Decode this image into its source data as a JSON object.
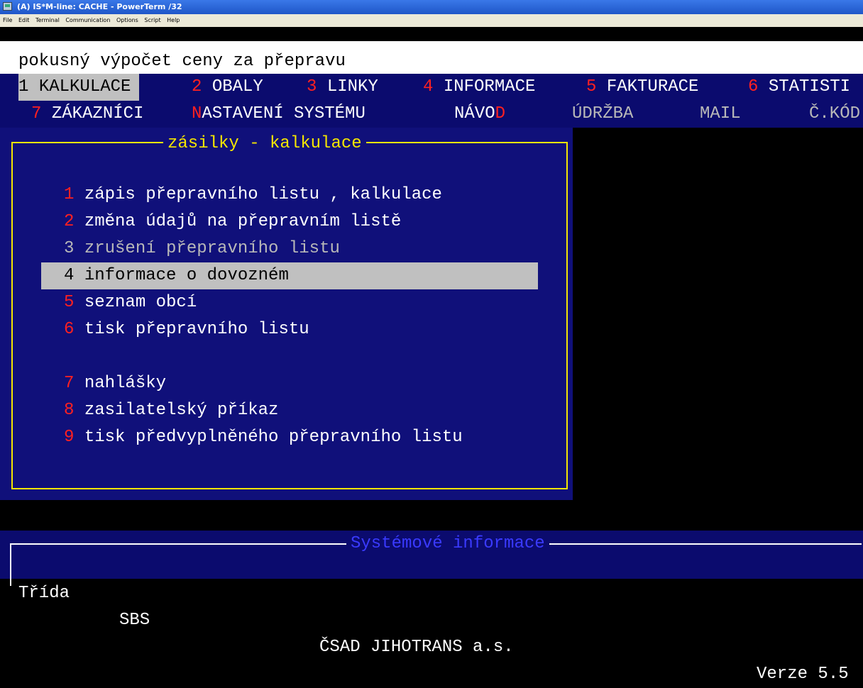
{
  "window": {
    "title": "(A) IS*M-line: CACHE - PowerTerm /32",
    "menu": [
      "File",
      "Edit",
      "Terminal",
      "Communication",
      "Options",
      "Script",
      "Help"
    ]
  },
  "header": {
    "title": "pokusný výpočet ceny za přepravu"
  },
  "main_menu": {
    "row1": [
      {
        "num": "1",
        "label": "KALKULACE",
        "selected": true
      },
      {
        "num": "2",
        "label": "OBALY"
      },
      {
        "num": "3",
        "label": "LINKY"
      },
      {
        "num": "4",
        "label": "INFORMACE"
      },
      {
        "num": "5",
        "label": "FAKTURACE"
      },
      {
        "num": "6",
        "label": "STATISTI"
      }
    ],
    "row2": {
      "zakaznici_num": "7",
      "zakaznici_label": "ZÁKAZNÍCI",
      "nastaveni_hot": "N",
      "nastaveni_rest": "ASTAVENÍ SYSTÉMU",
      "navod_main": "NÁVO",
      "navod_hot": "D",
      "udrzba": "ÚDRŽBA",
      "mail": "MAIL",
      "ckod": "Č.KÓD"
    }
  },
  "panel": {
    "title": "zásilky - kalkulace",
    "items": [
      {
        "num": "1",
        "label": "zápis přepravního listu , kalkulace"
      },
      {
        "num": "2",
        "label": "změna údajů na přepravním listě"
      },
      {
        "num": "3",
        "label": "zrušení přepravního listu",
        "disabled": true
      },
      {
        "num": "4",
        "label": "informace o dovozném",
        "selected": true
      },
      {
        "num": "5",
        "label": "seznam obcí"
      },
      {
        "num": "6",
        "label": "tisk přepravního listu"
      },
      {
        "num": "7",
        "label": "nahlášky"
      },
      {
        "num": "8",
        "label": "zasilatelský příkaz"
      },
      {
        "num": "9",
        "label": "tisk předvyplněného přepravního listu"
      }
    ]
  },
  "status": {
    "title": "Systémové informace",
    "trida_label": "Třída",
    "trida_value": "SBS",
    "company": "ČSAD JIHOTRANS a.s.",
    "version": "Verze 5.5"
  },
  "colors": {
    "hotkey": "#ff2020",
    "frame": "#f5e600",
    "panel_bg": "#10107a",
    "menu_bg": "#0b0b6e"
  }
}
